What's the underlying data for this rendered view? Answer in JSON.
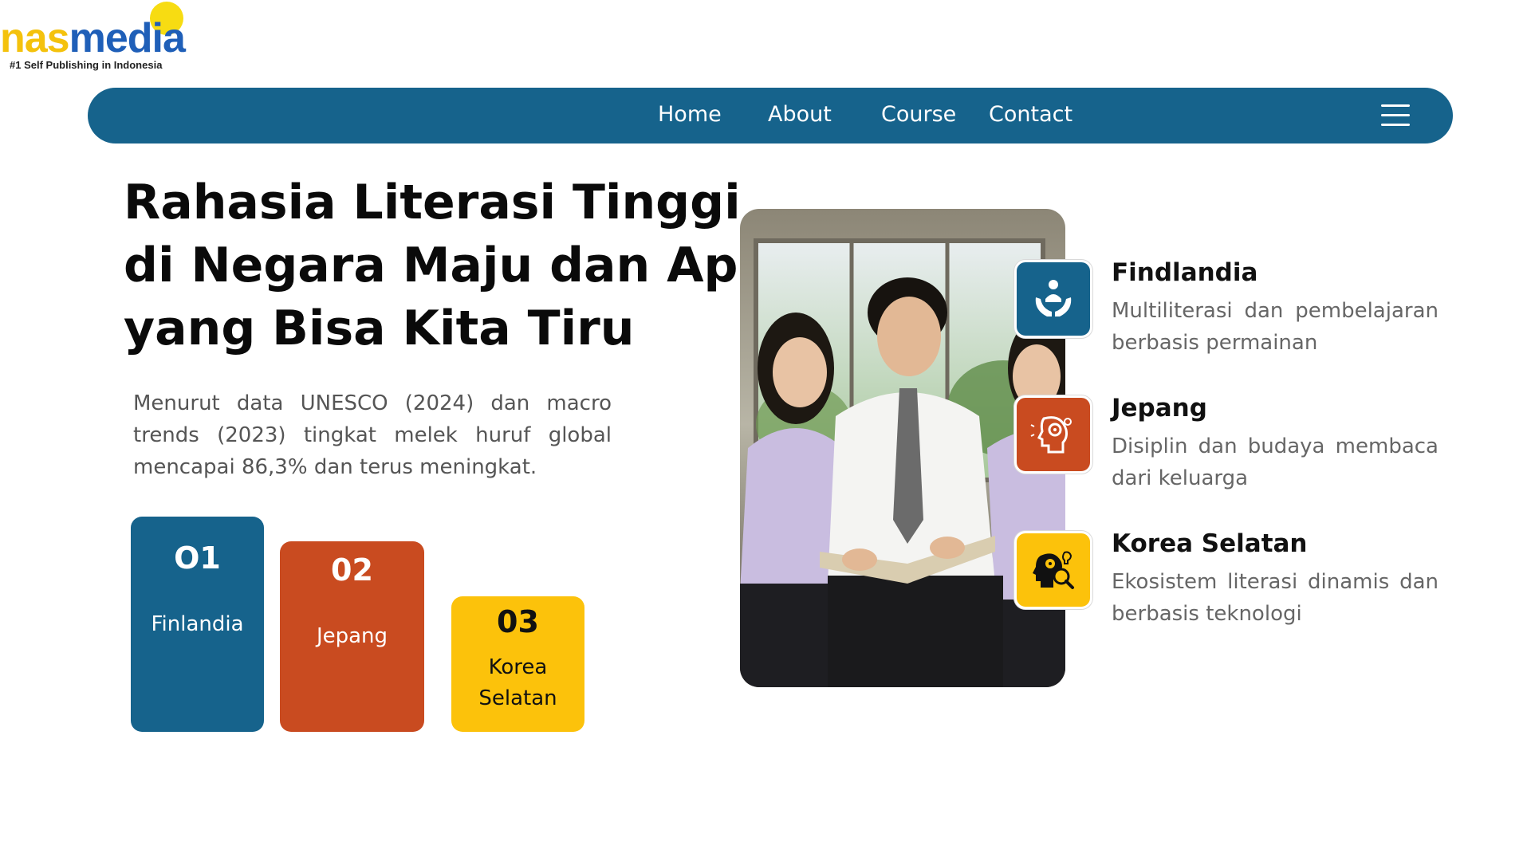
{
  "logo": {
    "part1": "nas",
    "part2": "media",
    "tagline": "#1 Self Publishing in Indonesia",
    "sun_color": "#f7dc12"
  },
  "nav": {
    "bg_color": "#16638c",
    "items": [
      {
        "label": "Home"
      },
      {
        "label": "About"
      },
      {
        "label": "Course"
      },
      {
        "label": "Contact"
      }
    ],
    "menu_icon": "hamburger-icon"
  },
  "hero": {
    "title_lines": [
      "Rahasia Literasi Tinggi",
      "di Negara Maju dan Apa",
      "yang Bisa Kita  Tiru"
    ],
    "intro": "Menurut data UNESCO (2024) dan macro trends (2023) tingkat melek huruf global mencapai 86,3% dan terus meningkat."
  },
  "cards": [
    {
      "number": "O1",
      "label": "Finlandia",
      "color": "#16638c"
    },
    {
      "number": "02",
      "label": "Jepang",
      "color": "#c94b20"
    },
    {
      "number": "03",
      "label": "Korea Selatan",
      "color": "#fcc20b"
    }
  ],
  "features": [
    {
      "title": "Findlandia",
      "description": "Multiliterasi dan pembelajaran berbasis permainan",
      "icon": "hands-person-icon",
      "color": "#16638c"
    },
    {
      "title": "Jepang",
      "description": "Disiplin dan budaya membaca dari keluarga",
      "icon": "head-gears-icon",
      "color": "#c94b20"
    },
    {
      "title": "Korea Selatan",
      "description": "Ekosistem literasi dinamis dan berbasis teknologi",
      "icon": "head-magnifier-icon",
      "color": "#fcc20b"
    }
  ]
}
